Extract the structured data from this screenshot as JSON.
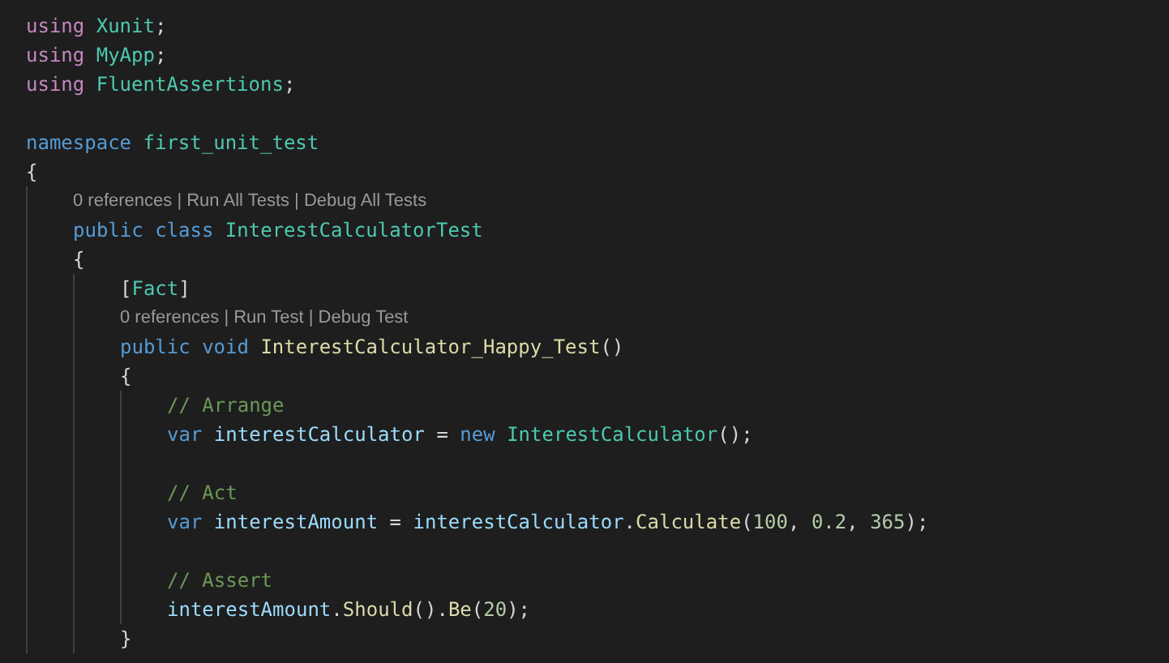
{
  "editor": {
    "lines": [
      {
        "kind": "code",
        "tokens": [
          {
            "kind": "keyword",
            "text": "using"
          },
          {
            "kind": "type",
            "text": " Xunit"
          },
          {
            "kind": "plain",
            "text": ";"
          }
        ]
      },
      {
        "kind": "code",
        "tokens": [
          {
            "kind": "keyword",
            "text": "using"
          },
          {
            "kind": "type",
            "text": " MyApp"
          },
          {
            "kind": "plain",
            "text": ";"
          }
        ]
      },
      {
        "kind": "code",
        "tokens": [
          {
            "kind": "keyword",
            "text": "using"
          },
          {
            "kind": "type",
            "text": " FluentAssertions"
          },
          {
            "kind": "plain",
            "text": ";"
          }
        ]
      },
      {
        "kind": "blank"
      },
      {
        "kind": "code",
        "tokens": [
          {
            "kind": "storage",
            "text": "namespace"
          },
          {
            "kind": "type",
            "text": " first_unit_test"
          }
        ]
      },
      {
        "kind": "code",
        "tokens": [
          {
            "kind": "plain",
            "text": "{"
          }
        ],
        "children": [
          {
            "kind": "codelens",
            "text": "0 references | Run All Tests | Debug All Tests"
          },
          {
            "kind": "code",
            "tokens": [
              {
                "kind": "storage",
                "text": "public class"
              },
              {
                "kind": "type",
                "text": " InterestCalculatorTest"
              }
            ]
          },
          {
            "kind": "code",
            "tokens": [
              {
                "kind": "plain",
                "text": "{"
              }
            ],
            "children": [
              {
                "kind": "code",
                "tokens": [
                  {
                    "kind": "plain",
                    "text": "["
                  },
                  {
                    "kind": "type",
                    "text": "Fact"
                  },
                  {
                    "kind": "plain",
                    "text": "]"
                  }
                ]
              },
              {
                "kind": "codelens",
                "text": "0 references | Run Test | Debug Test"
              },
              {
                "kind": "code",
                "tokens": [
                  {
                    "kind": "storage",
                    "text": "public void"
                  },
                  {
                    "kind": "function",
                    "text": " InterestCalculator_Happy_Test"
                  },
                  {
                    "kind": "plain",
                    "text": "()"
                  }
                ]
              },
              {
                "kind": "code",
                "tokens": [
                  {
                    "kind": "plain",
                    "text": "{"
                  }
                ],
                "children": [
                  {
                    "kind": "code",
                    "tokens": [
                      {
                        "kind": "comment",
                        "text": "// Arrange"
                      }
                    ]
                  },
                  {
                    "kind": "code",
                    "tokens": [
                      {
                        "kind": "storage",
                        "text": "var"
                      },
                      {
                        "kind": "variable",
                        "text": " interestCalculator"
                      },
                      {
                        "kind": "plain",
                        "text": " = "
                      },
                      {
                        "kind": "storage",
                        "text": "new"
                      },
                      {
                        "kind": "type",
                        "text": " InterestCalculator"
                      },
                      {
                        "kind": "plain",
                        "text": "();"
                      }
                    ]
                  },
                  {
                    "kind": "blank"
                  },
                  {
                    "kind": "code",
                    "tokens": [
                      {
                        "kind": "comment",
                        "text": "// Act"
                      }
                    ]
                  },
                  {
                    "kind": "code",
                    "tokens": [
                      {
                        "kind": "storage",
                        "text": "var"
                      },
                      {
                        "kind": "variable",
                        "text": " interestAmount"
                      },
                      {
                        "kind": "plain",
                        "text": " = "
                      },
                      {
                        "kind": "variable",
                        "text": "interestCalculator"
                      },
                      {
                        "kind": "plain",
                        "text": "."
                      },
                      {
                        "kind": "function",
                        "text": "Calculate"
                      },
                      {
                        "kind": "plain",
                        "text": "("
                      },
                      {
                        "kind": "number",
                        "text": "100"
                      },
                      {
                        "kind": "plain",
                        "text": ", "
                      },
                      {
                        "kind": "number",
                        "text": "0.2"
                      },
                      {
                        "kind": "plain",
                        "text": ", "
                      },
                      {
                        "kind": "number",
                        "text": "365"
                      },
                      {
                        "kind": "plain",
                        "text": ");"
                      }
                    ]
                  },
                  {
                    "kind": "blank"
                  },
                  {
                    "kind": "code",
                    "tokens": [
                      {
                        "kind": "comment",
                        "text": "// Assert"
                      }
                    ]
                  },
                  {
                    "kind": "code",
                    "tokens": [
                      {
                        "kind": "variable",
                        "text": "interestAmount"
                      },
                      {
                        "kind": "plain",
                        "text": "."
                      },
                      {
                        "kind": "function",
                        "text": "Should"
                      },
                      {
                        "kind": "plain",
                        "text": "()."
                      },
                      {
                        "kind": "function",
                        "text": "Be"
                      },
                      {
                        "kind": "plain",
                        "text": "("
                      },
                      {
                        "kind": "number",
                        "text": "20"
                      },
                      {
                        "kind": "plain",
                        "text": ");"
                      }
                    ]
                  }
                ]
              },
              {
                "kind": "code",
                "tokens": [
                  {
                    "kind": "plain",
                    "text": "}"
                  }
                ]
              }
            ]
          }
        ]
      }
    ]
  }
}
